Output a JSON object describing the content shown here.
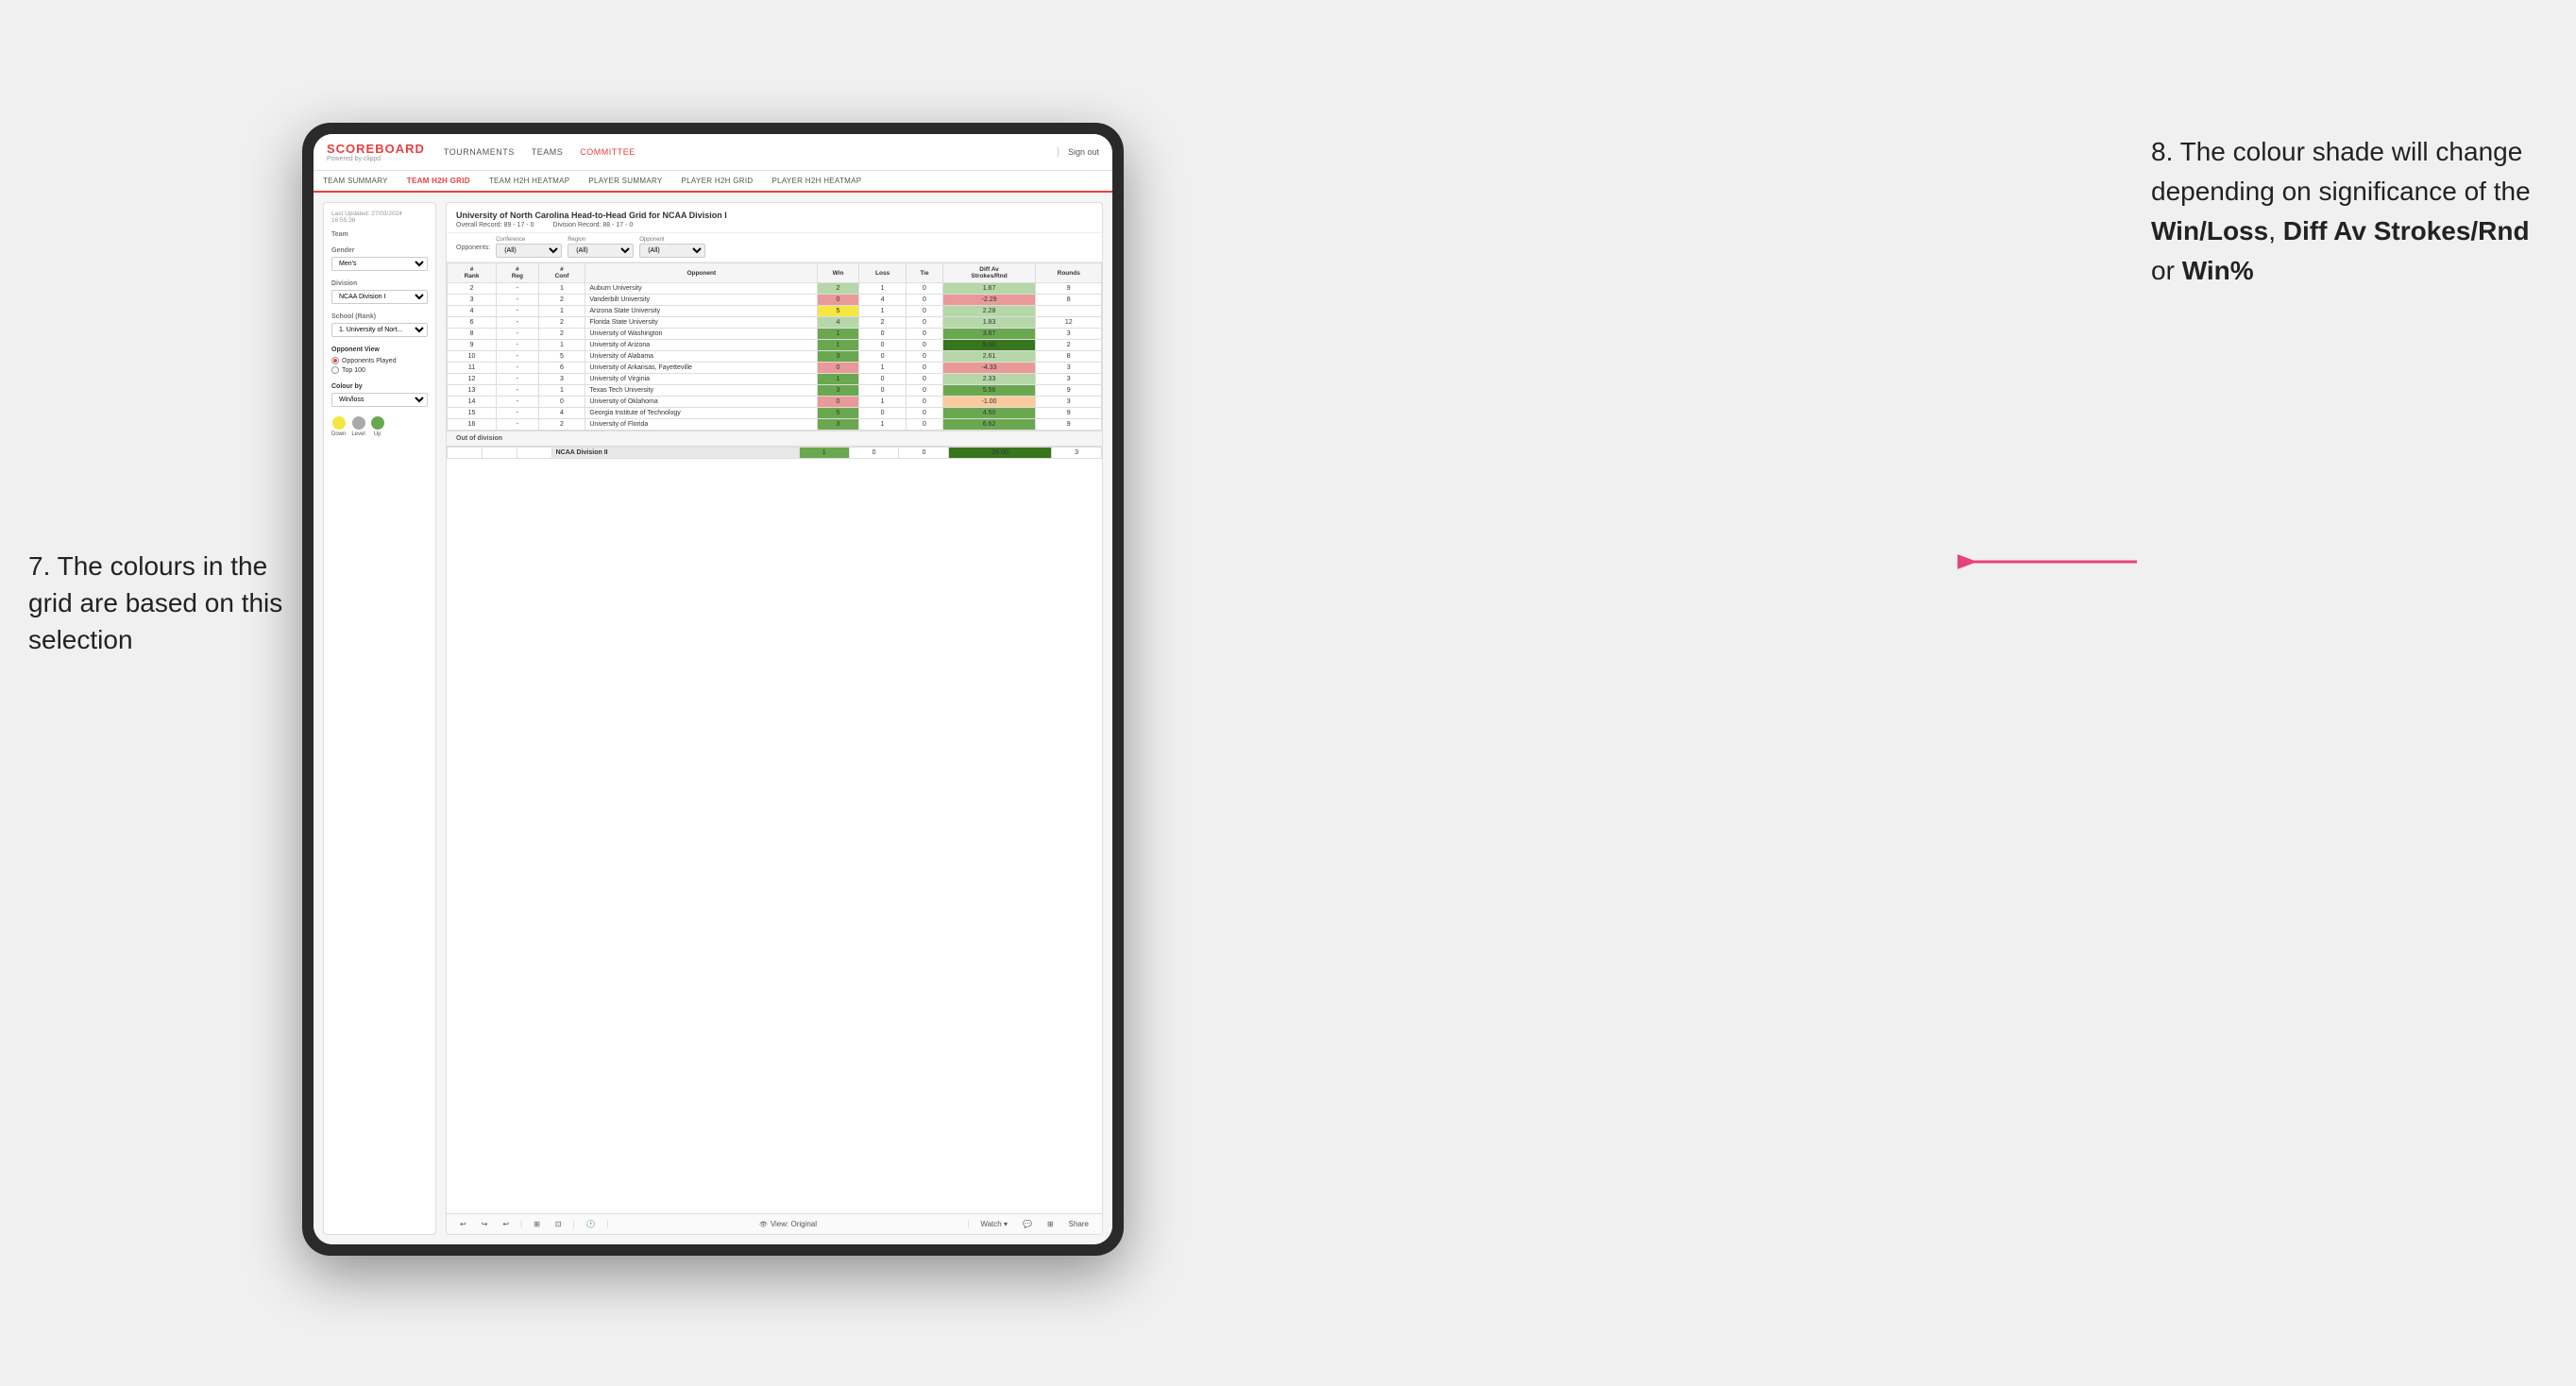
{
  "annotations": {
    "left_text": "7. The colours in the grid are based on this selection",
    "right_text_1": "8. The colour shade will change depending on significance of the ",
    "right_bold_1": "Win/Loss",
    "right_text_2": ", ",
    "right_bold_2": "Diff Av Strokes/Rnd",
    "right_text_3": " or ",
    "right_bold_3": "Win%"
  },
  "nav": {
    "logo": "SCOREBOARD",
    "logo_sub": "Powered by clippd",
    "links": [
      "TOURNAMENTS",
      "TEAMS",
      "COMMITTEE"
    ],
    "sign_out": "Sign out"
  },
  "sub_nav": {
    "items": [
      "TEAM SUMMARY",
      "TEAM H2H GRID",
      "TEAM H2H HEATMAP",
      "PLAYER SUMMARY",
      "PLAYER H2H GRID",
      "PLAYER H2H HEATMAP"
    ],
    "active": "TEAM H2H GRID"
  },
  "left_panel": {
    "last_updated_label": "Last Updated: 27/03/2024",
    "last_updated_time": "16:55:38",
    "team_label": "Team",
    "gender_label": "Gender",
    "gender_value": "Men's",
    "division_label": "Division",
    "division_value": "NCAA Division I",
    "school_label": "School (Rank)",
    "school_value": "1. University of Nort...",
    "opponent_view_label": "Opponent View",
    "radio1": "Opponents Played",
    "radio2": "Top 100",
    "colour_by_label": "Colour by",
    "colour_by_value": "Win/loss",
    "legend": {
      "down": "Down",
      "level": "Level",
      "up": "Up"
    }
  },
  "grid": {
    "title": "University of North Carolina Head-to-Head Grid for NCAA Division I",
    "overall_record": "Overall Record: 89 - 17 - 0",
    "division_record": "Division Record: 88 - 17 - 0",
    "filter_conference_label": "Conference",
    "filter_conference_value": "(All)",
    "filter_region_label": "Region",
    "filter_region_value": "(All)",
    "filter_opponent_label": "Opponent",
    "filter_opponent_value": "(All)",
    "opponents_label": "Opponents:",
    "columns": [
      "#\nRank",
      "#\nReg",
      "#\nConf",
      "Opponent",
      "Win",
      "Loss",
      "Tie",
      "Diff Av\nStrokes/Rnd",
      "Rounds"
    ],
    "rows": [
      {
        "rank": "2",
        "reg": "-",
        "conf": "1",
        "opponent": "Auburn University",
        "win": "2",
        "loss": "1",
        "tie": "0",
        "diff": "1.67",
        "rounds": "9",
        "win_color": "light-green",
        "diff_color": "light-green"
      },
      {
        "rank": "3",
        "reg": "-",
        "conf": "2",
        "opponent": "Vanderbilt University",
        "win": "0",
        "loss": "4",
        "tie": "0",
        "diff": "-2.29",
        "rounds": "8",
        "win_color": "red",
        "diff_color": "red"
      },
      {
        "rank": "4",
        "reg": "-",
        "conf": "1",
        "opponent": "Arizona State University",
        "win": "5",
        "loss": "1",
        "tie": "0",
        "diff": "2.28",
        "rounds": "",
        "win_color": "yellow",
        "diff_color": "light-green"
      },
      {
        "rank": "6",
        "reg": "-",
        "conf": "2",
        "opponent": "Florida State University",
        "win": "4",
        "loss": "2",
        "tie": "0",
        "diff": "1.83",
        "rounds": "12",
        "win_color": "light-green",
        "diff_color": "light-green"
      },
      {
        "rank": "8",
        "reg": "-",
        "conf": "2",
        "opponent": "University of Washington",
        "win": "1",
        "loss": "0",
        "tie": "0",
        "diff": "3.67",
        "rounds": "3",
        "win_color": "green",
        "diff_color": "green"
      },
      {
        "rank": "9",
        "reg": "-",
        "conf": "1",
        "opponent": "University of Arizona",
        "win": "1",
        "loss": "0",
        "tie": "0",
        "diff": "9.00",
        "rounds": "2",
        "win_color": "green",
        "diff_color": "dark-green"
      },
      {
        "rank": "10",
        "reg": "-",
        "conf": "5",
        "opponent": "University of Alabama",
        "win": "3",
        "loss": "0",
        "tie": "0",
        "diff": "2.61",
        "rounds": "8",
        "win_color": "green",
        "diff_color": "light-green"
      },
      {
        "rank": "11",
        "reg": "-",
        "conf": "6",
        "opponent": "University of Arkansas, Fayetteville",
        "win": "0",
        "loss": "1",
        "tie": "0",
        "diff": "-4.33",
        "rounds": "3",
        "win_color": "red",
        "diff_color": "red"
      },
      {
        "rank": "12",
        "reg": "-",
        "conf": "3",
        "opponent": "University of Virginia",
        "win": "1",
        "loss": "0",
        "tie": "0",
        "diff": "2.33",
        "rounds": "3",
        "win_color": "green",
        "diff_color": "light-green"
      },
      {
        "rank": "13",
        "reg": "-",
        "conf": "1",
        "opponent": "Texas Tech University",
        "win": "3",
        "loss": "0",
        "tie": "0",
        "diff": "5.56",
        "rounds": "9",
        "win_color": "green",
        "diff_color": "green"
      },
      {
        "rank": "14",
        "reg": "-",
        "conf": "0",
        "opponent": "University of Oklahoma",
        "win": "0",
        "loss": "1",
        "tie": "0",
        "diff": "-1.00",
        "rounds": "3",
        "win_color": "red",
        "diff_color": "orange"
      },
      {
        "rank": "15",
        "reg": "-",
        "conf": "4",
        "opponent": "Georgia Institute of Technology",
        "win": "5",
        "loss": "0",
        "tie": "0",
        "diff": "4.50",
        "rounds": "9",
        "win_color": "green",
        "diff_color": "green"
      },
      {
        "rank": "16",
        "reg": "-",
        "conf": "2",
        "opponent": "University of Florida",
        "win": "3",
        "loss": "1",
        "tie": "0",
        "diff": "6.62",
        "rounds": "9",
        "win_color": "green",
        "diff_color": "green"
      }
    ],
    "out_of_division_label": "Out of division",
    "out_of_division_row": {
      "name": "NCAA Division II",
      "win": "1",
      "loss": "0",
      "tie": "0",
      "diff": "26.00",
      "rounds": "3"
    }
  },
  "toolbar": {
    "view_label": "View: Original",
    "watch_label": "Watch ▾",
    "share_label": "Share"
  }
}
